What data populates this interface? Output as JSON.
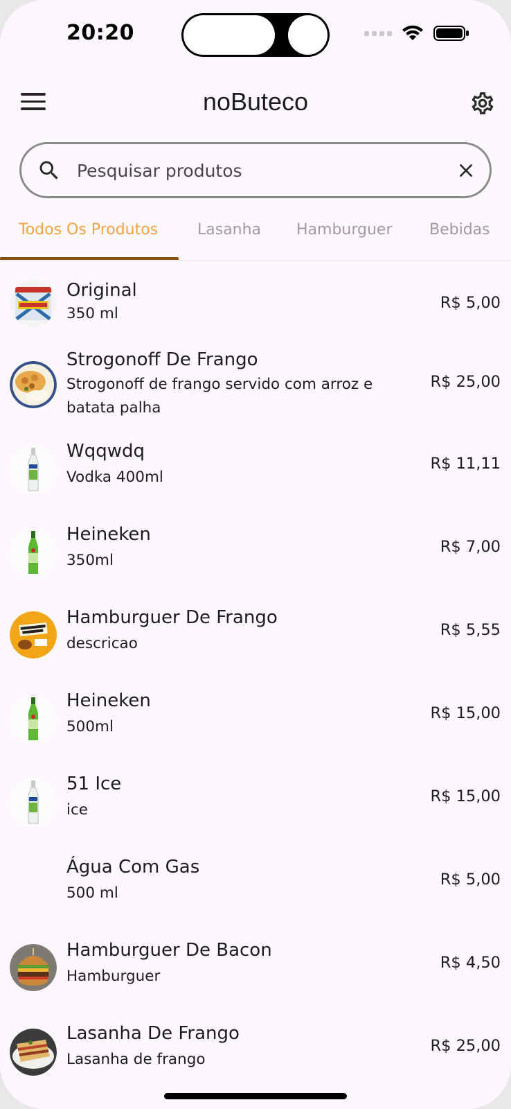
{
  "status_bar": {
    "time": "20:20"
  },
  "app_bar": {
    "title": "noButeco"
  },
  "search": {
    "placeholder": "Pesquisar produtos"
  },
  "tabs": [
    {
      "label": "Todos Os Produtos",
      "active": true
    },
    {
      "label": "Lasanha",
      "active": false
    },
    {
      "label": "Hamburguer",
      "active": false
    },
    {
      "label": "Bebidas",
      "active": false
    }
  ],
  "colors": {
    "accent": "#f3a23e",
    "indicator": "#8a5200"
  },
  "products": [
    {
      "name": "Original",
      "description": "350 ml",
      "price": "R$ 5,00",
      "image": "beer-can-original"
    },
    {
      "name": "Strogonoff De Frango",
      "description": "Strogonoff de frango servido com arroz e batata palha",
      "price": "R$ 25,00",
      "image": "strogonoff-dish"
    },
    {
      "name": "Wqqwdq",
      "description": "Vodka 400ml",
      "price": "R$ 11,11",
      "image": "ice-bottle"
    },
    {
      "name": "Heineken",
      "description": "350ml",
      "price": "R$ 7,00",
      "image": "green-beer-bottle"
    },
    {
      "name": "Hamburguer De Frango",
      "description": "descricao",
      "price": "R$ 5,55",
      "image": "burger-promo-poster"
    },
    {
      "name": "Heineken",
      "description": "500ml",
      "price": "R$ 15,00",
      "image": "green-beer-bottle"
    },
    {
      "name": "51 Ice",
      "description": "ice",
      "price": "R$ 15,00",
      "image": "ice-bottle"
    },
    {
      "name": "Água Com Gas",
      "description": "500 ml",
      "price": "R$ 5,00",
      "image": "none"
    },
    {
      "name": "Hamburguer De Bacon",
      "description": "Hamburguer",
      "price": "R$ 4,50",
      "image": "bacon-burger"
    },
    {
      "name": "Lasanha De Frango",
      "description": "Lasanha de frango",
      "price": "R$ 25,00",
      "image": "lasagna"
    }
  ]
}
